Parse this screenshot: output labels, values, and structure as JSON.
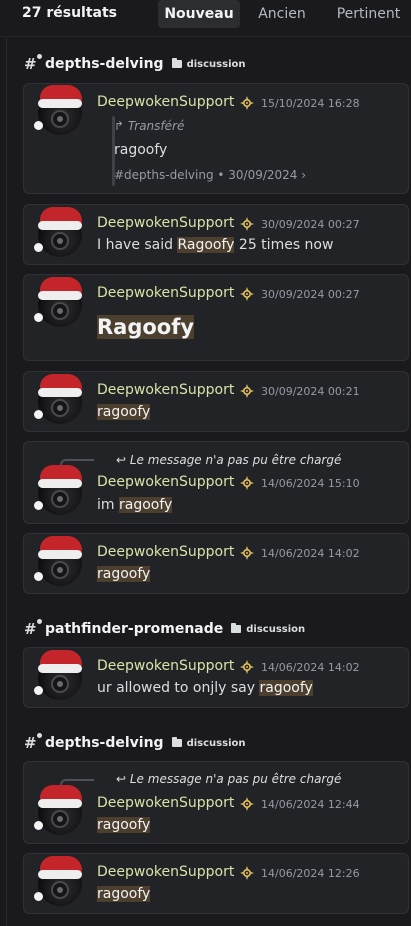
{
  "header": {
    "result_count": "27 résultats",
    "tabs": [
      {
        "label": "Nouveau",
        "active": true
      },
      {
        "label": "Ancien",
        "active": false
      },
      {
        "label": "Pertinent",
        "active": false
      }
    ]
  },
  "groups": [
    {
      "channel": "depths-delving",
      "type": "discussion"
    },
    {
      "channel": "pathfinder-promenade",
      "type": "discussion"
    },
    {
      "channel": "depths-delving",
      "type": "discussion"
    }
  ],
  "messages": [
    {
      "author": "DeepwokenSupport",
      "timestamp": "15/10/2024 16:28",
      "forward_label": "Transféré",
      "forward_text": "ragoofy",
      "forward_meta": "#depths-delving  •  30/09/2024  ›"
    },
    {
      "author": "DeepwokenSupport",
      "timestamp": "30/09/2024 00:27",
      "text_before": "I have said ",
      "text_hl": "Ragoofy",
      "text_after": " 25 times now"
    },
    {
      "author": "DeepwokenSupport",
      "timestamp": "30/09/2024 00:27",
      "text_hl": "Ragoofy"
    },
    {
      "author": "DeepwokenSupport",
      "timestamp": "30/09/2024 00:21",
      "text_hl": "ragoofy"
    },
    {
      "author": "DeepwokenSupport",
      "timestamp": "14/06/2024 15:10",
      "reply": "Le message n'a pas pu être chargé",
      "text_before": "im ",
      "text_hl": "ragoofy"
    },
    {
      "author": "DeepwokenSupport",
      "timestamp": "14/06/2024 14:02",
      "text_hl": "ragoofy"
    },
    {
      "author": "DeepwokenSupport",
      "timestamp": "14/06/2024 14:02",
      "text_before": "ur allowed to onjly say ",
      "text_hl": "ragoofy"
    },
    {
      "author": "DeepwokenSupport",
      "timestamp": "14/06/2024 12:44",
      "reply": "Le message n'a pas pu être chargé",
      "text_hl": "ragoofy"
    },
    {
      "author": "DeepwokenSupport",
      "timestamp": "14/06/2024 12:26",
      "text_hl": "ragoofy"
    }
  ],
  "colors": {
    "author": "#d8e3a6",
    "highlight": "#4d3f2d",
    "background": "#1a1a1e",
    "card": "#222327"
  },
  "icons": [
    "hashtag-thread-icon",
    "folder-icon",
    "mod-badge-icon",
    "forward-arrow-icon",
    "reply-arrow-icon",
    "chevron-right-icon"
  ]
}
